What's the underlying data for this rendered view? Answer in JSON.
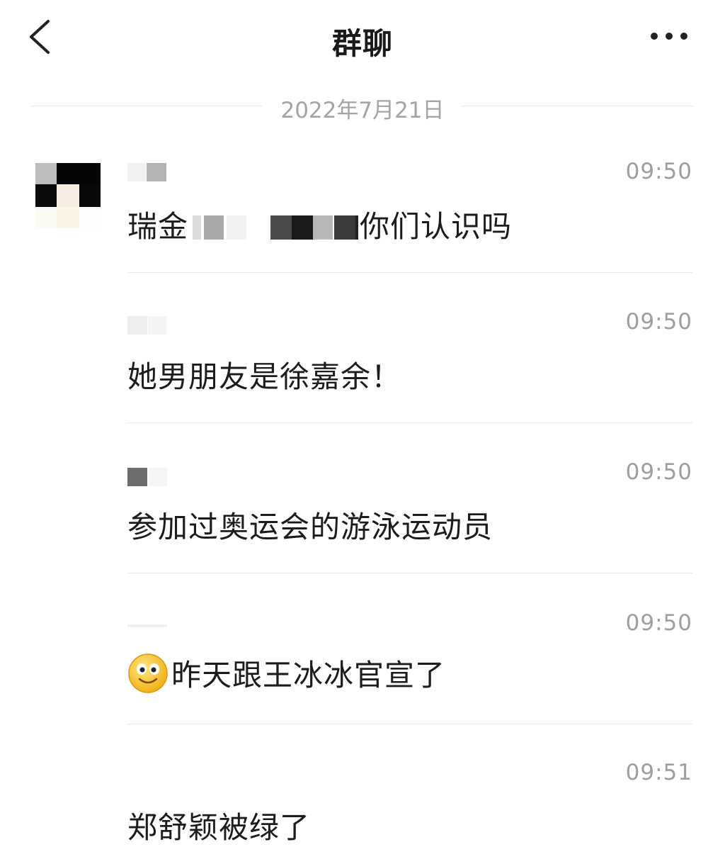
{
  "header": {
    "title": "群聊",
    "back_icon": "chevron-left-icon",
    "more_icon": "more-dots-icon"
  },
  "date_separator": "2022年7月21日",
  "messages": [
    {
      "time": "09:50",
      "text_before": "瑞金",
      "text_after": "你们认识吗"
    },
    {
      "time": "09:50",
      "text": "她男朋友是徐嘉余！"
    },
    {
      "time": "09:50",
      "text": "参加过奥运会的游泳运动员"
    },
    {
      "time": "09:50",
      "emoji": "smiley-face-icon",
      "text": "昨天跟王冰冰官宣了"
    },
    {
      "time": "09:51",
      "text": "郑舒颖被绿了"
    }
  ]
}
